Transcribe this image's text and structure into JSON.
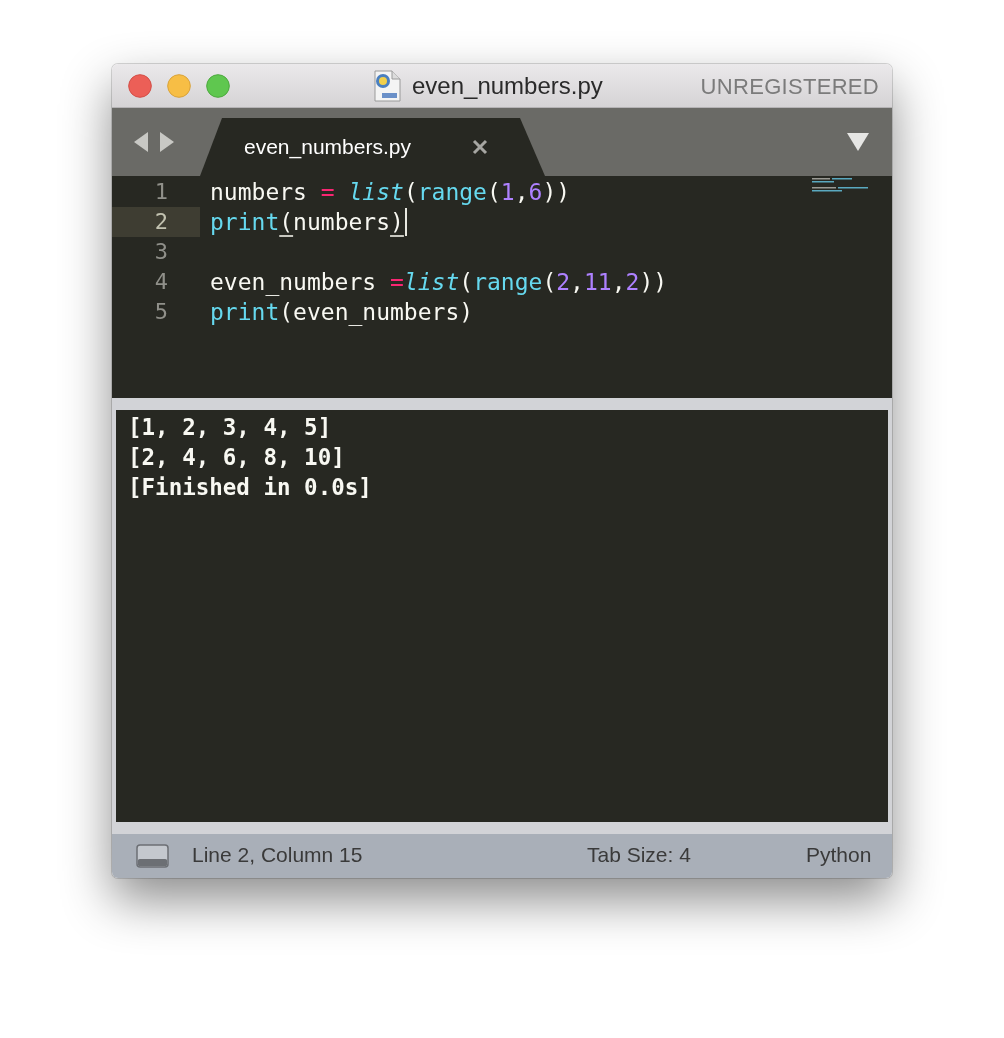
{
  "window": {
    "title": "even_numbers.py",
    "badge": "UNREGISTERED"
  },
  "tabs": [
    {
      "label": "even_numbers.py",
      "selected": true
    }
  ],
  "editor": {
    "lines": [
      {
        "number": "1",
        "current": false,
        "cursor": false,
        "tokens": [
          {
            "text": "numbers ",
            "kind": "plain"
          },
          {
            "text": "= ",
            "kind": "operator"
          },
          {
            "text": "list",
            "kind": "builtin"
          },
          {
            "text": "(",
            "kind": "plain"
          },
          {
            "text": "range",
            "kind": "function"
          },
          {
            "text": "(",
            "kind": "plain"
          },
          {
            "text": "1",
            "kind": "number"
          },
          {
            "text": ",",
            "kind": "plain"
          },
          {
            "text": "6",
            "kind": "number"
          },
          {
            "text": "))",
            "kind": "plain"
          }
        ]
      },
      {
        "number": "2",
        "current": true,
        "cursor": true,
        "tokens": [
          {
            "text": "print",
            "kind": "function"
          },
          {
            "text": "(",
            "kind": "bracket"
          },
          {
            "text": "numbers",
            "kind": "plain"
          },
          {
            "text": ")",
            "kind": "bracket"
          }
        ]
      },
      {
        "number": "3",
        "current": false,
        "cursor": false
      },
      {
        "number": "4",
        "current": false,
        "cursor": false,
        "tokens": [
          {
            "text": "even_numbers ",
            "kind": "plain"
          },
          {
            "text": "=",
            "kind": "operator"
          },
          {
            "text": "list",
            "kind": "builtin"
          },
          {
            "text": "(",
            "kind": "plain"
          },
          {
            "text": "range",
            "kind": "function"
          },
          {
            "text": "(",
            "kind": "plain"
          },
          {
            "text": "2",
            "kind": "number"
          },
          {
            "text": ",",
            "kind": "plain"
          },
          {
            "text": "11",
            "kind": "number"
          },
          {
            "text": ",",
            "kind": "plain"
          },
          {
            "text": "2",
            "kind": "number"
          },
          {
            "text": "))",
            "kind": "plain"
          }
        ]
      },
      {
        "number": "5",
        "current": false,
        "cursor": false,
        "tokens": [
          {
            "text": "print",
            "kind": "function"
          },
          {
            "text": "(even_numbers)",
            "kind": "plain"
          }
        ]
      }
    ]
  },
  "output": {
    "lines": [
      "[1, 2, 3, 4, 5]",
      "[2, 4, 6, 8, 10]",
      "[Finished in 0.0s]"
    ]
  },
  "status_bar": {
    "position": "Line 2, Column 15",
    "tab_size": "Tab Size: 4",
    "syntax": "Python"
  }
}
